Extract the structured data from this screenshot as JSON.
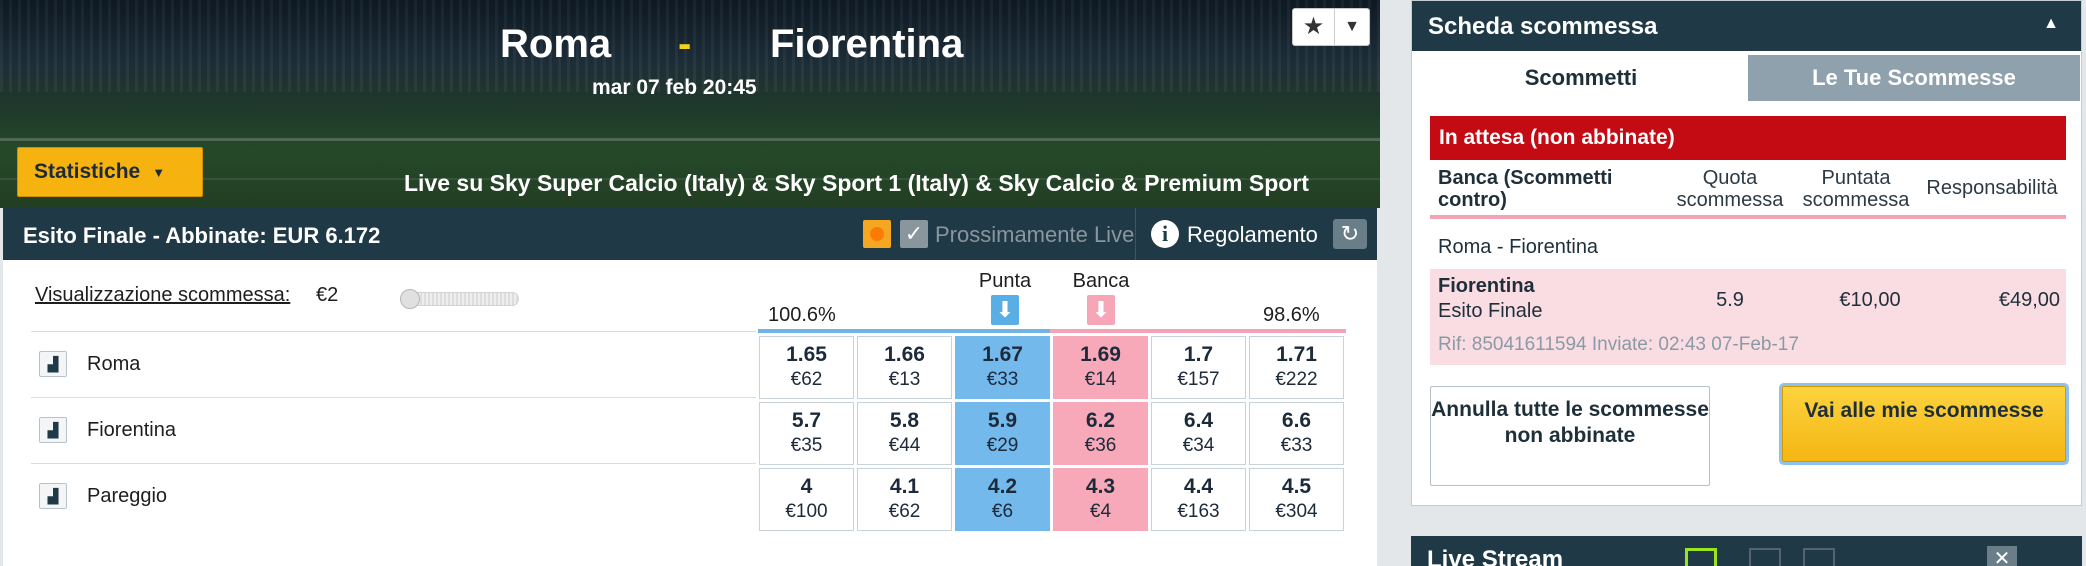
{
  "hero": {
    "home_team": "Roma",
    "separator": "-",
    "away_team": "Fiorentina",
    "date": "mar 07 feb 20:45",
    "fav_icon": "star-icon",
    "stats_label": "Statistiche",
    "tv": "Live su Sky Super Calcio (Italy) & Sky Sport 1 (Italy) & Sky Calcio & Premium Sport"
  },
  "market": {
    "title": "Esito Finale - Abbinate: EUR 6.172",
    "coming_live": "Prossimamente Live",
    "rules": "Regolamento",
    "view_label": "Visualizzazione scommessa:",
    "view_value": "€2",
    "back_pct": "100.6%",
    "lay_pct": "98.6%",
    "back_header": "Punta",
    "lay_header": "Banca",
    "runners": [
      {
        "name": "Roma",
        "prices": [
          {
            "odds": "1.65",
            "amount": "€62"
          },
          {
            "odds": "1.66",
            "amount": "€13"
          },
          {
            "odds": "1.67",
            "amount": "€33"
          },
          {
            "odds": "1.69",
            "amount": "€14"
          },
          {
            "odds": "1.7",
            "amount": "€157"
          },
          {
            "odds": "1.71",
            "amount": "€222"
          }
        ]
      },
      {
        "name": "Fiorentina",
        "prices": [
          {
            "odds": "5.7",
            "amount": "€35"
          },
          {
            "odds": "5.8",
            "amount": "€44"
          },
          {
            "odds": "5.9",
            "amount": "€29"
          },
          {
            "odds": "6.2",
            "amount": "€36"
          },
          {
            "odds": "6.4",
            "amount": "€34"
          },
          {
            "odds": "6.6",
            "amount": "€33"
          }
        ]
      },
      {
        "name": "Pareggio",
        "prices": [
          {
            "odds": "4",
            "amount": "€100"
          },
          {
            "odds": "4.1",
            "amount": "€62"
          },
          {
            "odds": "4.2",
            "amount": "€6"
          },
          {
            "odds": "4.3",
            "amount": "€4"
          },
          {
            "odds": "4.4",
            "amount": "€163"
          },
          {
            "odds": "4.5",
            "amount": "€304"
          }
        ]
      }
    ]
  },
  "slip": {
    "title": "Scheda scommessa",
    "tab_bets": "Scommetti",
    "tab_my_bets": "Le Tue Scommesse",
    "pending": "In attesa (non abbinate)",
    "col_lay": "Banca (Scommetti contro)",
    "col_odds": "Quota scommessa",
    "col_stake": "Puntata scommessa",
    "col_liability": "Responsabilità",
    "event": "Roma - Fiorentina",
    "bet_runner": "Fiorentina",
    "bet_market": "Esito Finale",
    "bet_odds": "5.9",
    "bet_stake": "€10,00",
    "bet_liability": "€49,00",
    "bet_ref": "Rif: 85041611594 Inviate: 02:43 07-Feb-17",
    "cancel_all": "Annulla tutte le scommesse non abbinate",
    "go_to_bets": "Vai alle mie scommesse"
  },
  "live_stream": {
    "title": "Live Stream"
  },
  "colors": {
    "navy": "#1f3947",
    "back": "#73b9ec",
    "lay": "#f7a9b9",
    "accent_yellow": "#f6b20f",
    "pending_red": "#c40a13"
  }
}
